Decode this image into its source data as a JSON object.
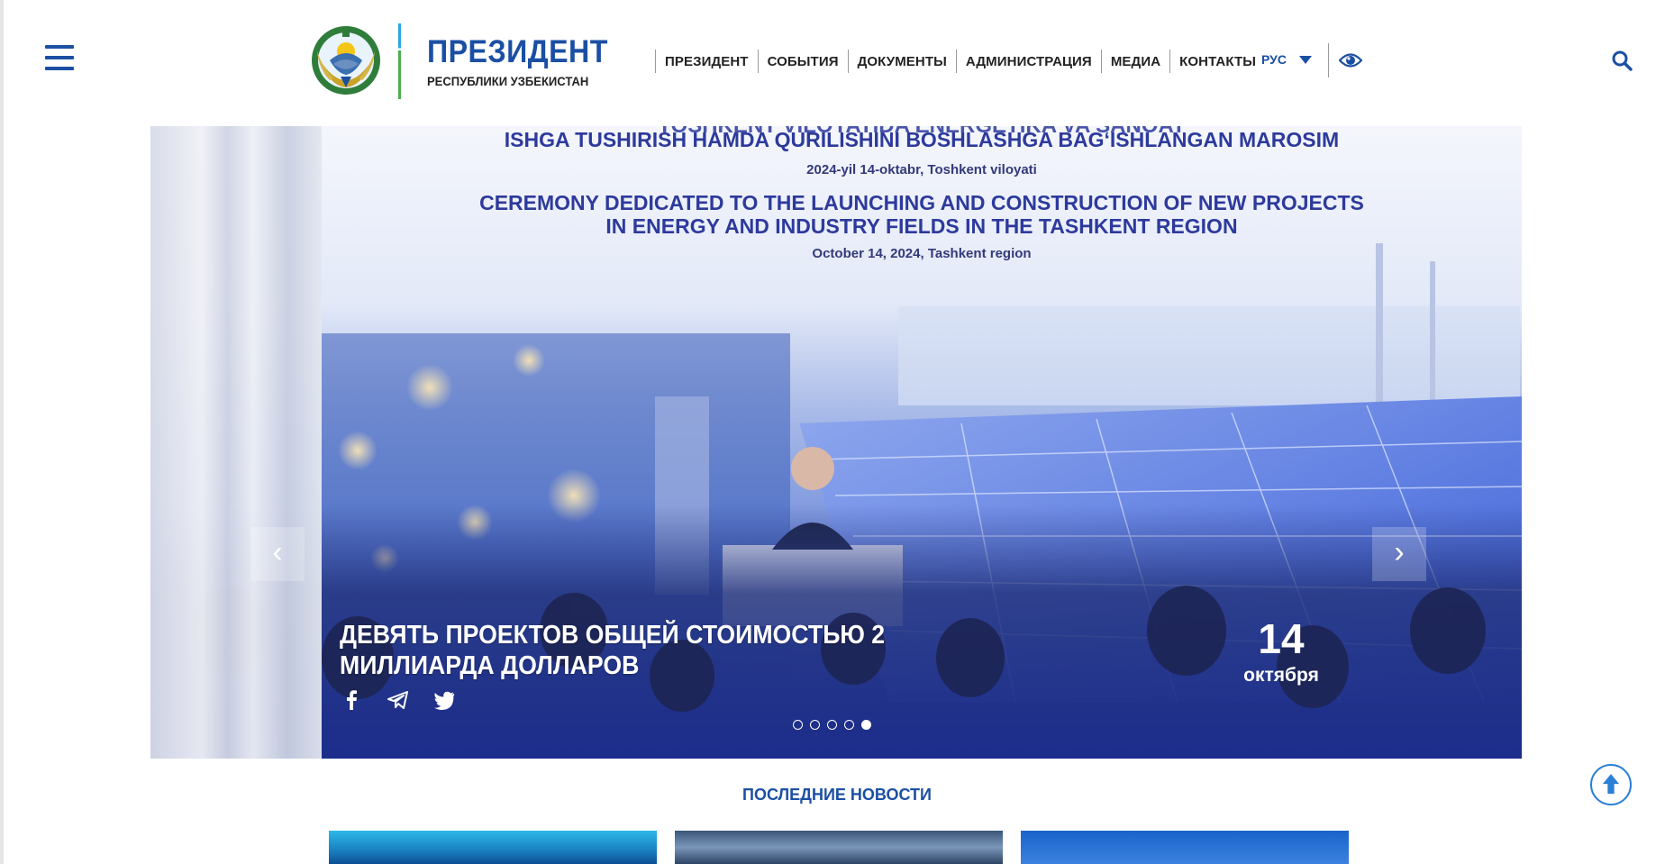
{
  "header": {
    "logo_title": "ПРЕЗИДЕНТ",
    "logo_subtitle": "РЕСПУБЛИКИ УЗБЕКИСТАН",
    "nav": [
      "ПРЕЗИДЕНТ",
      "СОБЫТИЯ",
      "ДОКУМЕНТЫ",
      "АДМИНИСТРАЦИЯ",
      "МЕДИА",
      "КОНТАКТЫ"
    ],
    "language": "РУС",
    "icons": {
      "menu": "hamburger-menu-icon",
      "accessibility": "eye-icon",
      "search": "search-icon"
    }
  },
  "hero": {
    "banner": {
      "line1": "TOSHKENT VILOYATIDA ENERGETIKA VA SANOAT",
      "line2": "ISHGA TUSHIRISH HAMDA QURILISHINI BOSHLASHGA BAG‘ISHLANGAN MAROSIM",
      "line3": "2024-yil 14-oktabr, Toshkent viloyati",
      "line4": "CEREMONY DEDICATED TO THE LAUNCHING AND CONSTRUCTION OF NEW PROJECTS",
      "line5": "IN ENERGY AND INDUSTRY FIELDS IN THE TASHKENT REGION",
      "line6": "October 14, 2024, Tashkent region"
    },
    "title": "ДЕВЯТЬ ПРОЕКТОВ ОБЩЕЙ СТОИМОСТЬЮ 2 МИЛЛИАРДА ДОЛЛАРОВ",
    "day": "14",
    "month": "октября",
    "prev_label": "‹",
    "next_label": "›",
    "slide_count": 5,
    "active_slide": 5,
    "social": [
      "facebook-icon",
      "telegram-icon",
      "twitter-icon"
    ]
  },
  "news": {
    "section_title": "ПОСЛЕДНИЕ НОВОСТИ"
  },
  "colors": {
    "brand_blue": "#1b4fa3",
    "accent_light_blue": "#2b7fd6"
  }
}
